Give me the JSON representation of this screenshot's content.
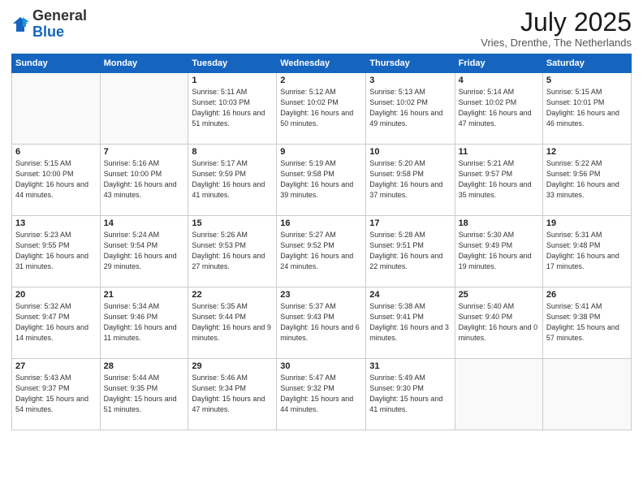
{
  "header": {
    "logo_general": "General",
    "logo_blue": "Blue",
    "month": "July 2025",
    "location": "Vries, Drenthe, The Netherlands"
  },
  "days_of_week": [
    "Sunday",
    "Monday",
    "Tuesday",
    "Wednesday",
    "Thursday",
    "Friday",
    "Saturday"
  ],
  "weeks": [
    [
      {
        "num": "",
        "info": ""
      },
      {
        "num": "",
        "info": ""
      },
      {
        "num": "1",
        "info": "Sunrise: 5:11 AM\nSunset: 10:03 PM\nDaylight: 16 hours\nand 51 minutes."
      },
      {
        "num": "2",
        "info": "Sunrise: 5:12 AM\nSunset: 10:02 PM\nDaylight: 16 hours\nand 50 minutes."
      },
      {
        "num": "3",
        "info": "Sunrise: 5:13 AM\nSunset: 10:02 PM\nDaylight: 16 hours\nand 49 minutes."
      },
      {
        "num": "4",
        "info": "Sunrise: 5:14 AM\nSunset: 10:02 PM\nDaylight: 16 hours\nand 47 minutes."
      },
      {
        "num": "5",
        "info": "Sunrise: 5:15 AM\nSunset: 10:01 PM\nDaylight: 16 hours\nand 46 minutes."
      }
    ],
    [
      {
        "num": "6",
        "info": "Sunrise: 5:15 AM\nSunset: 10:00 PM\nDaylight: 16 hours\nand 44 minutes."
      },
      {
        "num": "7",
        "info": "Sunrise: 5:16 AM\nSunset: 10:00 PM\nDaylight: 16 hours\nand 43 minutes."
      },
      {
        "num": "8",
        "info": "Sunrise: 5:17 AM\nSunset: 9:59 PM\nDaylight: 16 hours\nand 41 minutes."
      },
      {
        "num": "9",
        "info": "Sunrise: 5:19 AM\nSunset: 9:58 PM\nDaylight: 16 hours\nand 39 minutes."
      },
      {
        "num": "10",
        "info": "Sunrise: 5:20 AM\nSunset: 9:58 PM\nDaylight: 16 hours\nand 37 minutes."
      },
      {
        "num": "11",
        "info": "Sunrise: 5:21 AM\nSunset: 9:57 PM\nDaylight: 16 hours\nand 35 minutes."
      },
      {
        "num": "12",
        "info": "Sunrise: 5:22 AM\nSunset: 9:56 PM\nDaylight: 16 hours\nand 33 minutes."
      }
    ],
    [
      {
        "num": "13",
        "info": "Sunrise: 5:23 AM\nSunset: 9:55 PM\nDaylight: 16 hours\nand 31 minutes."
      },
      {
        "num": "14",
        "info": "Sunrise: 5:24 AM\nSunset: 9:54 PM\nDaylight: 16 hours\nand 29 minutes."
      },
      {
        "num": "15",
        "info": "Sunrise: 5:26 AM\nSunset: 9:53 PM\nDaylight: 16 hours\nand 27 minutes."
      },
      {
        "num": "16",
        "info": "Sunrise: 5:27 AM\nSunset: 9:52 PM\nDaylight: 16 hours\nand 24 minutes."
      },
      {
        "num": "17",
        "info": "Sunrise: 5:28 AM\nSunset: 9:51 PM\nDaylight: 16 hours\nand 22 minutes."
      },
      {
        "num": "18",
        "info": "Sunrise: 5:30 AM\nSunset: 9:49 PM\nDaylight: 16 hours\nand 19 minutes."
      },
      {
        "num": "19",
        "info": "Sunrise: 5:31 AM\nSunset: 9:48 PM\nDaylight: 16 hours\nand 17 minutes."
      }
    ],
    [
      {
        "num": "20",
        "info": "Sunrise: 5:32 AM\nSunset: 9:47 PM\nDaylight: 16 hours\nand 14 minutes."
      },
      {
        "num": "21",
        "info": "Sunrise: 5:34 AM\nSunset: 9:46 PM\nDaylight: 16 hours\nand 11 minutes."
      },
      {
        "num": "22",
        "info": "Sunrise: 5:35 AM\nSunset: 9:44 PM\nDaylight: 16 hours\nand 9 minutes."
      },
      {
        "num": "23",
        "info": "Sunrise: 5:37 AM\nSunset: 9:43 PM\nDaylight: 16 hours\nand 6 minutes."
      },
      {
        "num": "24",
        "info": "Sunrise: 5:38 AM\nSunset: 9:41 PM\nDaylight: 16 hours\nand 3 minutes."
      },
      {
        "num": "25",
        "info": "Sunrise: 5:40 AM\nSunset: 9:40 PM\nDaylight: 16 hours\nand 0 minutes."
      },
      {
        "num": "26",
        "info": "Sunrise: 5:41 AM\nSunset: 9:38 PM\nDaylight: 15 hours\nand 57 minutes."
      }
    ],
    [
      {
        "num": "27",
        "info": "Sunrise: 5:43 AM\nSunset: 9:37 PM\nDaylight: 15 hours\nand 54 minutes."
      },
      {
        "num": "28",
        "info": "Sunrise: 5:44 AM\nSunset: 9:35 PM\nDaylight: 15 hours\nand 51 minutes."
      },
      {
        "num": "29",
        "info": "Sunrise: 5:46 AM\nSunset: 9:34 PM\nDaylight: 15 hours\nand 47 minutes."
      },
      {
        "num": "30",
        "info": "Sunrise: 5:47 AM\nSunset: 9:32 PM\nDaylight: 15 hours\nand 44 minutes."
      },
      {
        "num": "31",
        "info": "Sunrise: 5:49 AM\nSunset: 9:30 PM\nDaylight: 15 hours\nand 41 minutes."
      },
      {
        "num": "",
        "info": ""
      },
      {
        "num": "",
        "info": ""
      }
    ]
  ]
}
